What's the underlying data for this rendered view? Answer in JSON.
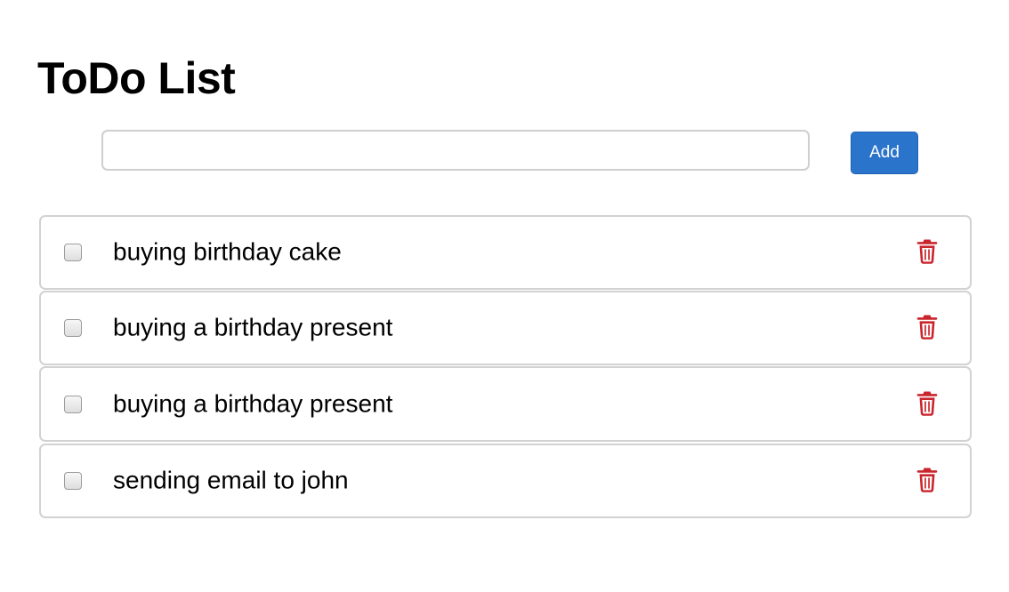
{
  "header": {
    "title": "ToDo List"
  },
  "form": {
    "input_value": "",
    "input_placeholder": "",
    "add_label": "Add"
  },
  "todos": [
    {
      "text": "buying birthday cake",
      "checked": false
    },
    {
      "text": "buying a birthday present",
      "checked": false
    },
    {
      "text": "buying a birthday present",
      "checked": false
    },
    {
      "text": "sending email to john",
      "checked": false
    }
  ],
  "icons": {
    "delete": "trash-icon"
  },
  "colors": {
    "accent": "#2b74cb",
    "delete": "#c9252c",
    "border": "#d2d2d2"
  }
}
